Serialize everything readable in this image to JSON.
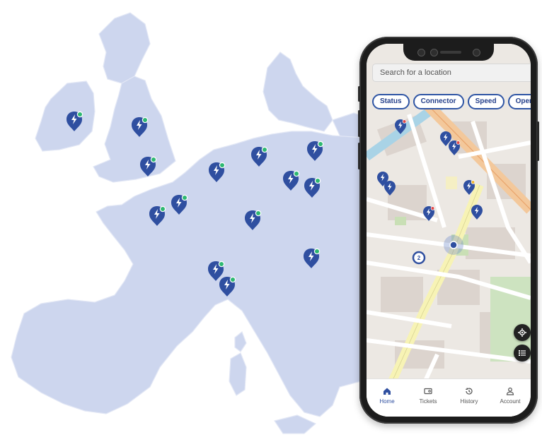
{
  "phone": {
    "search": {
      "placeholder": "Search for a location"
    },
    "filters": [
      {
        "label": "Status"
      },
      {
        "label": "Connector"
      },
      {
        "label": "Speed"
      },
      {
        "label": "Operator"
      }
    ],
    "cluster_count": "2",
    "nav": [
      {
        "label": "Home",
        "icon": "home-icon",
        "active": true
      },
      {
        "label": "Tickets",
        "icon": "ticket-icon",
        "active": false
      },
      {
        "label": "History",
        "icon": "history-icon",
        "active": false
      },
      {
        "label": "Account",
        "icon": "account-icon",
        "active": false
      }
    ]
  },
  "colors": {
    "land": "#cdd6ee",
    "pin": "#2f4fa0",
    "available": "#2eb872",
    "unavailable": "#e04848",
    "busy": "#f1b731",
    "accent": "#2f55a4"
  }
}
